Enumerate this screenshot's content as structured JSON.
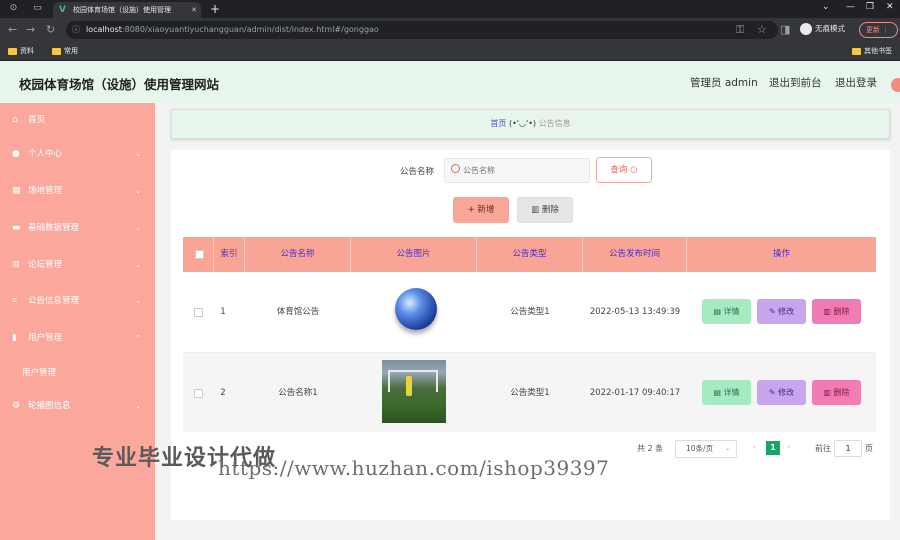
{
  "browser": {
    "tab_title": "校园体育场馆（设施）使用管理",
    "url_host": "localhost",
    "url_rest": ":8080/xiaoyuantiyuchangguan/admin/dist/index.html#/gonggao",
    "incognito_label": "无痕模式",
    "update_label": "更新",
    "bookmarks": [
      "资料",
      "常用"
    ],
    "other_bookmarks": "其他书签"
  },
  "header": {
    "site_title": "校园体育场馆（设施）使用管理网站",
    "admin_label": "管理员 admin",
    "back_frontend": "退出到前台",
    "logout": "退出登录"
  },
  "sidebar": {
    "items": [
      {
        "label": "首页",
        "icon": "home-icon"
      },
      {
        "label": "个人中心",
        "icon": "user-icon"
      },
      {
        "label": "场地管理",
        "icon": "building-icon"
      },
      {
        "label": "基础数据管理",
        "icon": "ticket-icon"
      },
      {
        "label": "论坛管理",
        "icon": "grid-icon"
      },
      {
        "label": "公告信息管理",
        "icon": "crop-icon"
      },
      {
        "label": "用户管理",
        "icon": "chart-icon"
      },
      {
        "label": "轮播图信息",
        "icon": "gear-icon"
      }
    ],
    "sub_item": "用户管理"
  },
  "breadcrumb": {
    "home": "首页",
    "emoji": "(•'◡'•)",
    "current": "公告信息"
  },
  "search": {
    "label": "公告名称",
    "placeholder": "公告名称",
    "query_label": "查询"
  },
  "actions": {
    "add_label": "新增",
    "delete_label": "删除"
  },
  "table": {
    "columns": [
      "索引",
      "公告名称",
      "公告图片",
      "公告类型",
      "公告发布时间",
      "操作"
    ],
    "rows": [
      {
        "index": "1",
        "name": "体育馆公告",
        "type": "公告类型1",
        "time": "2022-05-13 13:49:39"
      },
      {
        "index": "2",
        "name": "公告名称1",
        "type": "公告类型1",
        "time": "2022-01-17 09:40:17"
      }
    ],
    "btn_detail": "详情",
    "btn_edit": "修改",
    "btn_delete": "删除"
  },
  "pagination": {
    "total": "共 2 条",
    "page_size": "10条/页",
    "current_page": "1",
    "goto_label": "前往",
    "goto_value": "1",
    "page_suffix": "页"
  },
  "watermark": {
    "cn": "专业毕业设计代做",
    "url": "https://www.huzhan.com/ishop39397"
  },
  "colors": {
    "sidebar": "#fba79c",
    "header": "#e8f5ec",
    "table_header": "#f9a596",
    "accent_text": "#4a2fc7",
    "page_active": "#1aa26b"
  }
}
